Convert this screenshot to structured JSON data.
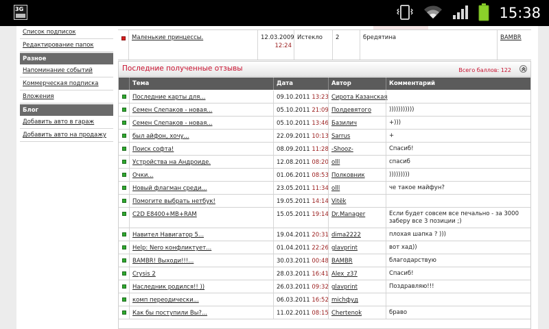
{
  "status_bar": {
    "network_badge": "3G",
    "time": "15:38",
    "icons": [
      "vibrate-icon",
      "wifi-icon",
      "signal-icon",
      "battery-icon"
    ]
  },
  "sidebar": {
    "items_top": [
      {
        "label": "Список подписок"
      },
      {
        "label": "Редактирование папок"
      }
    ],
    "section_misc": "Разное",
    "items_misc": [
      {
        "label": "Напоминание событий"
      },
      {
        "label": "Коммерческая подписка"
      },
      {
        "label": "Вложения"
      }
    ],
    "section_blog": "Блог",
    "items_blog": [
      {
        "label": "Добавить авто в гараж"
      },
      {
        "label": "Добавить авто на продажу"
      }
    ]
  },
  "top_table": {
    "row": {
      "title": "Маленькие принцессы.",
      "date": "12.03.2009",
      "time": "12:24",
      "status": "Истекло",
      "count": "2",
      "comment": "бредятина",
      "author": "BAMBR"
    }
  },
  "reviews": {
    "title": "Последние полученные отзывы",
    "total_label": "Всего баллов: 122",
    "columns": [
      "Тема",
      "Дата",
      "Автор",
      "Комментарий"
    ],
    "rows": [
      {
        "topic": "Последние карты для...",
        "date": "09.10.2011",
        "time": "13:23",
        "author": "Сирота Казанская",
        "comment": ""
      },
      {
        "topic": "Семен Слепаков - новая...",
        "date": "05.10.2011",
        "time": "21:09",
        "author": "Полдевятого",
        "comment": ")))))))))))"
      },
      {
        "topic": "Семен Слепаков - новая...",
        "date": "05.10.2011",
        "time": "13:46",
        "author": "Базилич",
        "comment": "+)))"
      },
      {
        "topic": "был айфон, хочу...",
        "date": "22.09.2011",
        "time": "10:13",
        "author": "Sarrus",
        "comment": "+"
      },
      {
        "topic": "Поиск софта!",
        "date": "08.09.2011",
        "time": "11:28",
        "author": "-Shooz-",
        "comment": "Спасиб!"
      },
      {
        "topic": "Устройства на Андроиде.",
        "date": "12.08.2011",
        "time": "08:20",
        "author": "olll",
        "comment": "спасиб"
      },
      {
        "topic": "Очки...",
        "date": "01.06.2011",
        "time": "08:53",
        "author": "Полковник",
        "comment": ")))))))))"
      },
      {
        "topic": "Новый флагман среди...",
        "date": "23.05.2011",
        "time": "11:34",
        "author": "olll",
        "comment": "че такое майфун?"
      },
      {
        "topic": "Помогите выбрать нетбук!",
        "date": "19.05.2011",
        "time": "14:14",
        "author": "Vitёk",
        "comment": ""
      },
      {
        "topic": "C2D E8400+MB+RAM",
        "date": "15.05.2011",
        "time": "19:14",
        "author": "Dr.Manager",
        "comment": "Если будет совсем все печально - за 3000 заберу все 3 позиции ;)"
      },
      {
        "topic": "Навител Навигатор 5...",
        "date": "19.04.2011",
        "time": "20:31",
        "author": "dima2222",
        "comment": "плохая шапка ? )))"
      },
      {
        "topic": "Help: Nero конфликтует...",
        "date": "01.04.2011",
        "time": "22:26",
        "author": "glavprint",
        "comment": "вот хад))"
      },
      {
        "topic": "BAMBR! Выходи!!!...",
        "date": "30.03.2011",
        "time": "00:48",
        "author": "BAMBR",
        "comment": "благодарствую"
      },
      {
        "topic": "Crysis 2",
        "date": "28.03.2011",
        "time": "16:41",
        "author": "Alex_z37",
        "comment": "Спасиб!"
      },
      {
        "topic": "Наследник родился!! ))",
        "date": "26.03.2011",
        "time": "09:32",
        "author": "glavprint",
        "comment": "Поздравляю!!!"
      },
      {
        "topic": "комп переодически...",
        "date": "06.03.2011",
        "time": "16:52",
        "author": "michфуд",
        "comment": ""
      },
      {
        "topic": "Как бы поступили Вы?...",
        "date": "11.02.2011",
        "time": "08:15",
        "author": "Chertenok",
        "comment": "браво"
      }
    ]
  }
}
